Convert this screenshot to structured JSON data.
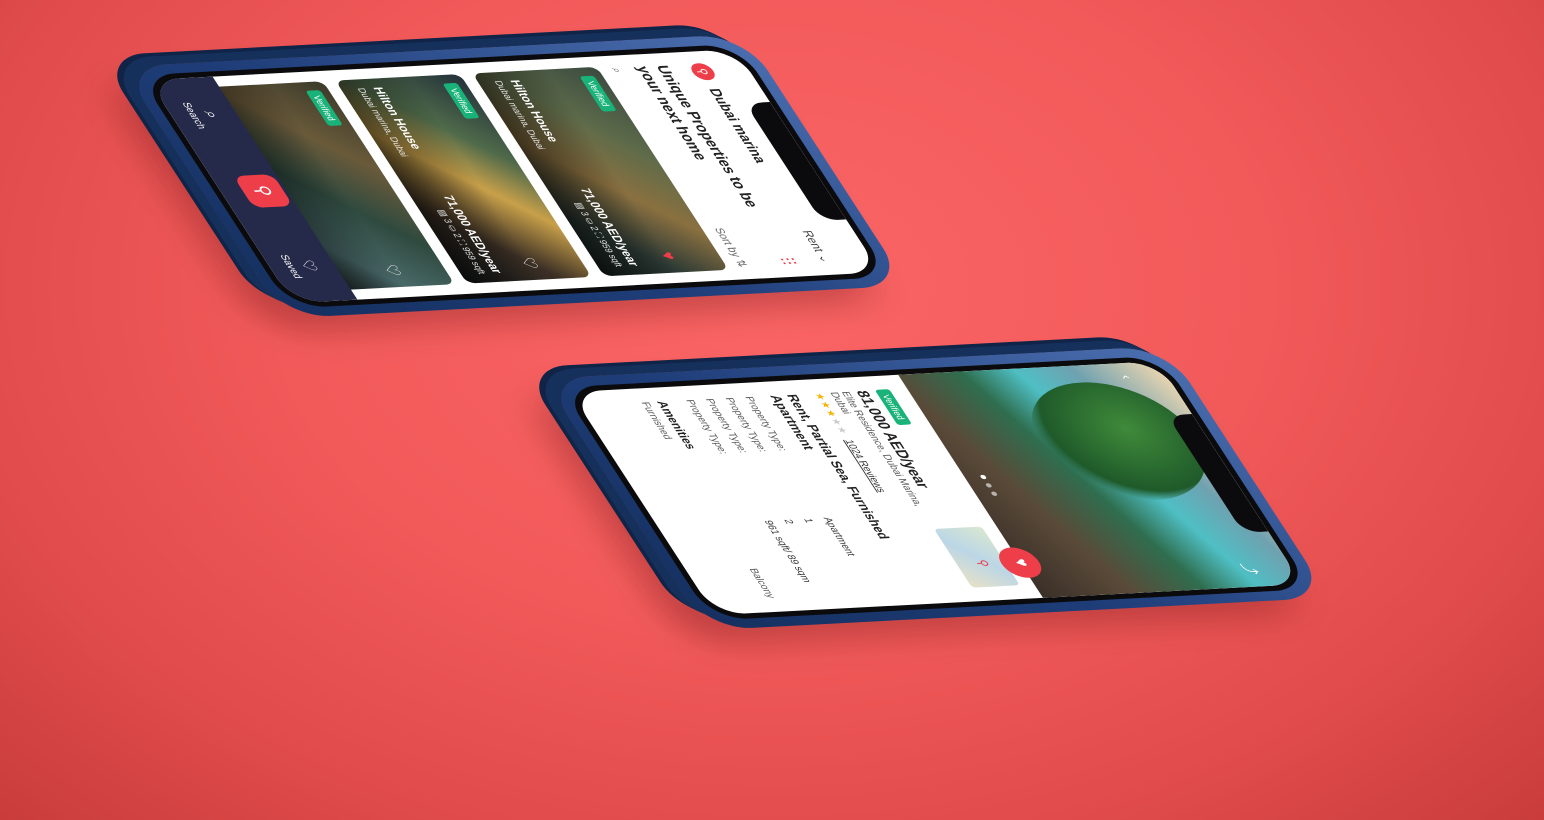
{
  "app": {
    "accent_color": "#ee3e4a",
    "verified_color": "#19b37a",
    "tabbar_color": "#262a4a"
  },
  "search_screen": {
    "location": "Dubai marina",
    "rent_dropdown": "Rent ⌄",
    "heading": "Unique Properties to be your next home",
    "sort_label": "Sort by ⇅",
    "listings": [
      {
        "badge": "Verified",
        "name": "Hilton House",
        "location": "Dubai marina, Dubai",
        "price": "71,000 AED/year",
        "meta": "▤ 3  ⛀ 2  ⛶ 959 sqft",
        "saved": true
      },
      {
        "badge": "Verified",
        "name": "Hilton House",
        "location": "Dubai marina, Dubai",
        "price": "71,000 AED/year",
        "meta": "▤ 3  ⛀ 2  ⛶ 959 sqft",
        "saved": false
      },
      {
        "badge": "Verified",
        "name": "",
        "location": "",
        "price": "",
        "meta": "",
        "saved": false
      }
    ],
    "tabs": {
      "search": "Search",
      "saved": "Saved"
    }
  },
  "detail_screen": {
    "badge": "Verified",
    "price": "81,000 AED/year",
    "address": "Elite Residence, Dubai Marina, Dubai",
    "stars_on": "★★★",
    "stars_off": "★★",
    "reviews": "1024 Reviews",
    "title": "Rent, Partial Sea, Furnished Apartment",
    "properties": [
      {
        "label": "Property Type:",
        "value": "Apartment"
      },
      {
        "label": "Property Type:",
        "value": "1"
      },
      {
        "label": "Property Type:",
        "value": "2"
      },
      {
        "label": "Property Type:",
        "value": "961 sqft/ 89 sqm"
      }
    ],
    "amenities_heading": "Amenities",
    "amenities": [
      "Furnished",
      "Balcony"
    ]
  }
}
